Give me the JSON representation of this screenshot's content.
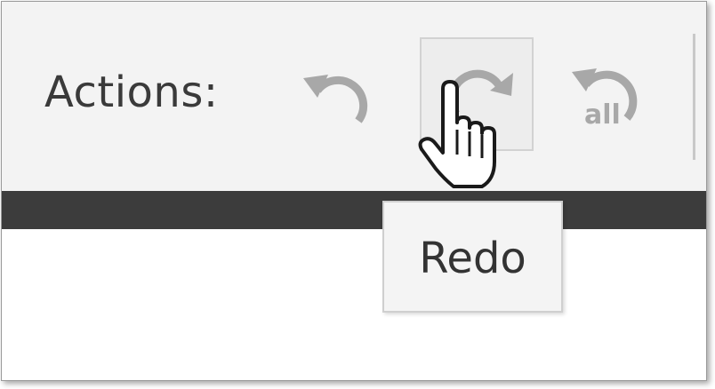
{
  "toolbar": {
    "label": "Actions:",
    "buttons": [
      {
        "name": "undo",
        "icon": "undo-icon",
        "state": "disabled"
      },
      {
        "name": "redo",
        "icon": "redo-icon",
        "state": "hovered"
      },
      {
        "name": "undo-all",
        "icon": "undo-all-icon",
        "icon_text": "all",
        "state": "disabled"
      }
    ]
  },
  "tooltip": {
    "text": "Redo"
  },
  "colors": {
    "toolbar_bg": "#f3f3f3",
    "icon_disabled": "#a8a8a8",
    "strip": "#3c3c3c",
    "tooltip_bg": "#f4f4f4"
  }
}
